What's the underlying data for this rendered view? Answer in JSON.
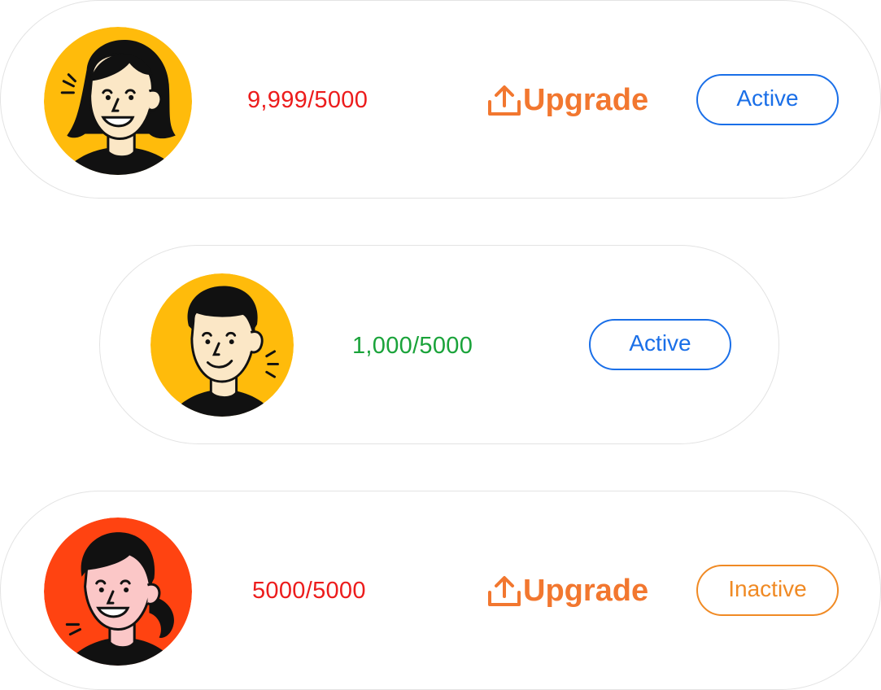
{
  "colors": {
    "over_limit": "#ec1c1c",
    "under_limit": "#1aa33a",
    "upgrade": "#f2772f",
    "active": "#1a6fe8",
    "inactive": "#f08a24",
    "avatar_yellow": "#ffbb0b",
    "avatar_red": "#ff4311",
    "card_border": "#e3e3e3"
  },
  "rows": [
    {
      "avatar_icon": "woman-short-hair-avatar-icon",
      "usage": "9,999/5000",
      "upgrade_icon": "upload-icon",
      "upgrade_label": "Upgrade",
      "status": "Active"
    },
    {
      "avatar_icon": "man-avatar-icon",
      "usage": "1,000/5000",
      "status": "Active"
    },
    {
      "avatar_icon": "woman-ponytail-avatar-icon",
      "usage": "5000/5000",
      "upgrade_icon": "upload-icon",
      "upgrade_label": "Upgrade",
      "status": "Inactive"
    }
  ]
}
